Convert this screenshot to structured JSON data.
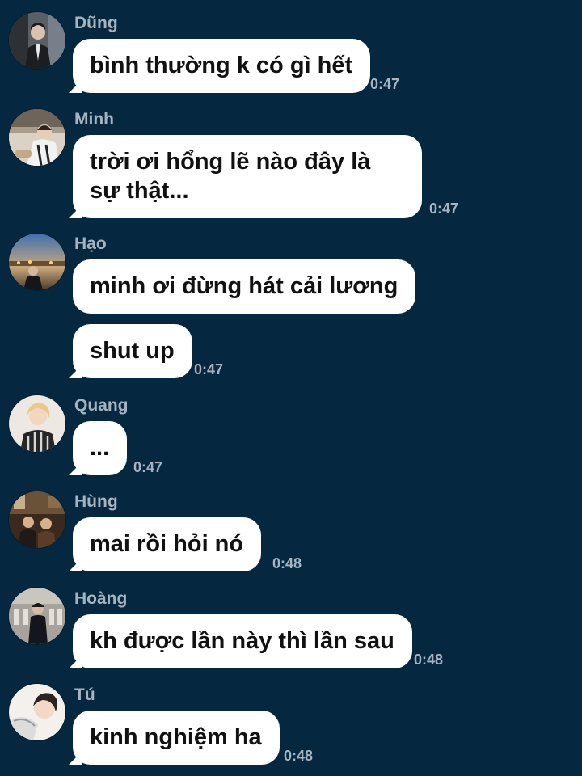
{
  "messages": [
    {
      "sender": "Dũng",
      "lines": [
        "bình thường k có gì hết"
      ],
      "time": "0:47"
    },
    {
      "sender": "Minh",
      "lines": [
        "trời ơi hổng lẽ nào đây là sự thật..."
      ],
      "time": "0:47"
    },
    {
      "sender": "Hạo",
      "lines": [
        "minh ơi đừng hát cải lương",
        "shut up"
      ],
      "time": "0:47"
    },
    {
      "sender": "Quang",
      "lines": [
        "..."
      ],
      "time": "0:47"
    },
    {
      "sender": "Hùng",
      "lines": [
        "mai rồi hỏi nó"
      ],
      "time": "0:48"
    },
    {
      "sender": "Hoàng",
      "lines": [
        "kh được lần này thì lần sau"
      ],
      "time": "0:48"
    },
    {
      "sender": "Tú",
      "lines": [
        "kinh nghiệm ha"
      ],
      "time": "0:48"
    }
  ]
}
